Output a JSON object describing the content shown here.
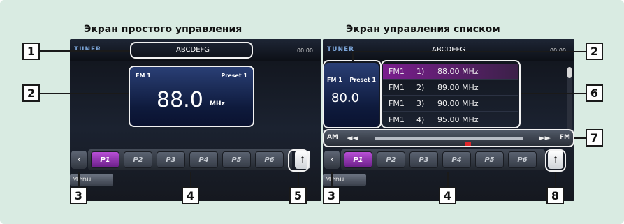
{
  "left_panel": {
    "caption": "Экран простого управления",
    "tuner_logo": "TUNER",
    "title": "ABCDEFG",
    "clock": "00:00",
    "freq_box": {
      "band": "FM 1",
      "preset": "Preset 1",
      "frequency": "88.0",
      "unit": "MHz"
    },
    "presets": [
      "P1",
      "P2",
      "P3",
      "P4",
      "P5",
      "P6"
    ],
    "active_preset": "P1",
    "menu_label": "Menu"
  },
  "right_panel": {
    "caption": "Экран управления списком",
    "tuner_logo": "TUNER",
    "title": "ABCDEFG",
    "clock": "00:00",
    "freq_box": {
      "band": "FM 1",
      "preset": "Preset 1",
      "frequency": "80.0"
    },
    "preset_list": [
      {
        "band": "FM1",
        "num": "1)",
        "freq": "88.00 MHz",
        "selected": true
      },
      {
        "band": "FM1",
        "num": "2)",
        "freq": "89.00 MHz",
        "selected": false
      },
      {
        "band": "FM1",
        "num": "3)",
        "freq": "90.00 MHz",
        "selected": false
      },
      {
        "band": "FM1",
        "num": "4)",
        "freq": "95.00 MHz",
        "selected": false
      }
    ],
    "seek": {
      "am": "AM",
      "fm": "FM",
      "left": "◄◄",
      "right": "►►"
    },
    "presets": [
      "P1",
      "P2",
      "P3",
      "P4",
      "P5",
      "P6"
    ],
    "active_preset": "P1",
    "menu_label": "Menu"
  },
  "callouts": [
    "1",
    "2",
    "3",
    "4",
    "5",
    "2",
    "6",
    "7",
    "3",
    "4",
    "8"
  ],
  "colors": {
    "background": "#d9ebe2",
    "accent_purple": "#b84fd6",
    "seek_marker": "#e0262b"
  }
}
